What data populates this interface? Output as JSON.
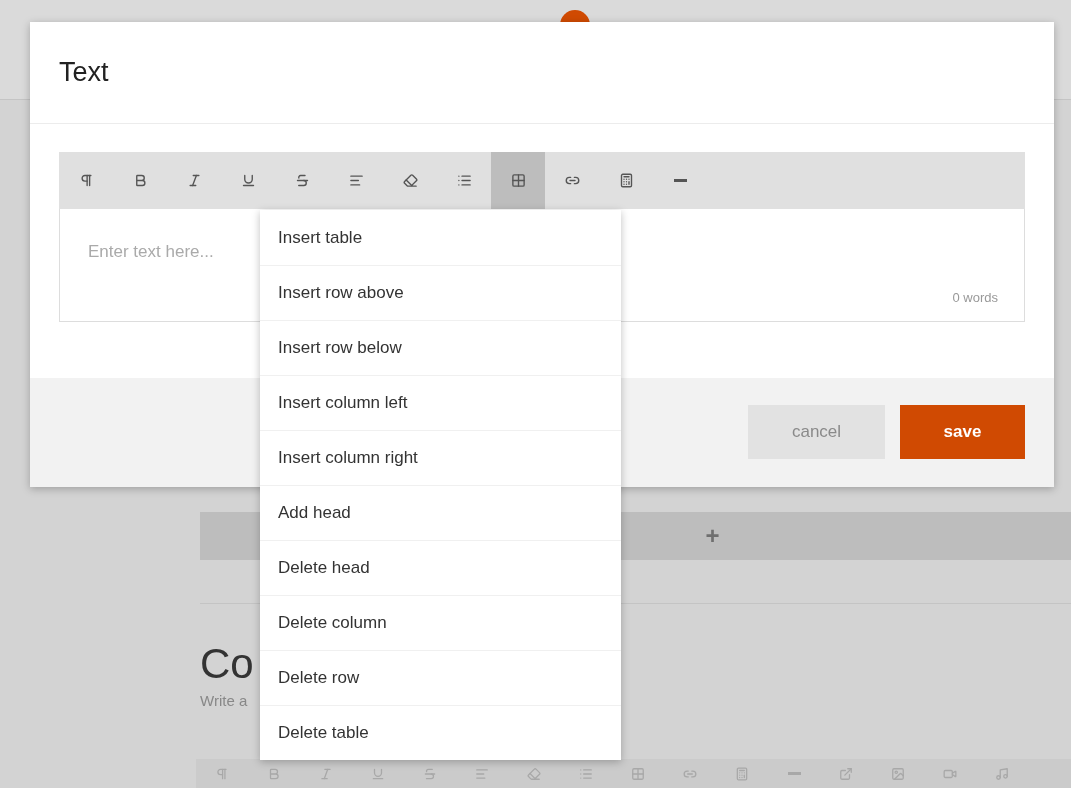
{
  "background": {
    "add_button": "+",
    "heading": "Co",
    "subtitle": "Write a",
    "toolbar": [
      {
        "kind": "paragraph"
      },
      {
        "kind": "bold"
      },
      {
        "kind": "italic"
      },
      {
        "kind": "underline"
      },
      {
        "kind": "strike"
      },
      {
        "kind": "align"
      },
      {
        "kind": "eraser"
      },
      {
        "kind": "list"
      },
      {
        "kind": "table"
      },
      {
        "kind": "link"
      },
      {
        "kind": "calculator"
      },
      {
        "kind": "rule"
      },
      {
        "kind": "external"
      },
      {
        "kind": "image"
      },
      {
        "kind": "video"
      },
      {
        "kind": "music"
      }
    ]
  },
  "modal": {
    "title": "Text",
    "toolbar": [
      {
        "kind": "paragraph",
        "selected": false
      },
      {
        "kind": "bold",
        "selected": false
      },
      {
        "kind": "italic",
        "selected": false
      },
      {
        "kind": "underline",
        "selected": false
      },
      {
        "kind": "strike",
        "selected": false
      },
      {
        "kind": "align",
        "selected": false
      },
      {
        "kind": "eraser",
        "selected": false
      },
      {
        "kind": "list",
        "selected": false
      },
      {
        "kind": "table",
        "selected": true
      },
      {
        "kind": "link",
        "selected": false
      },
      {
        "kind": "calculator",
        "selected": false
      },
      {
        "kind": "rule",
        "selected": false
      }
    ],
    "editor": {
      "placeholder": "Enter text here...",
      "word_count": "0 words"
    },
    "buttons": [
      {
        "label": "cancel",
        "kind": "secondary"
      },
      {
        "label": "save",
        "kind": "primary"
      }
    ]
  },
  "table_menu": {
    "items": [
      "Insert table",
      "Insert row above",
      "Insert row below",
      "Insert column left",
      "Insert column right",
      "Add head",
      "Delete head",
      "Delete column",
      "Delete row",
      "Delete table"
    ]
  }
}
